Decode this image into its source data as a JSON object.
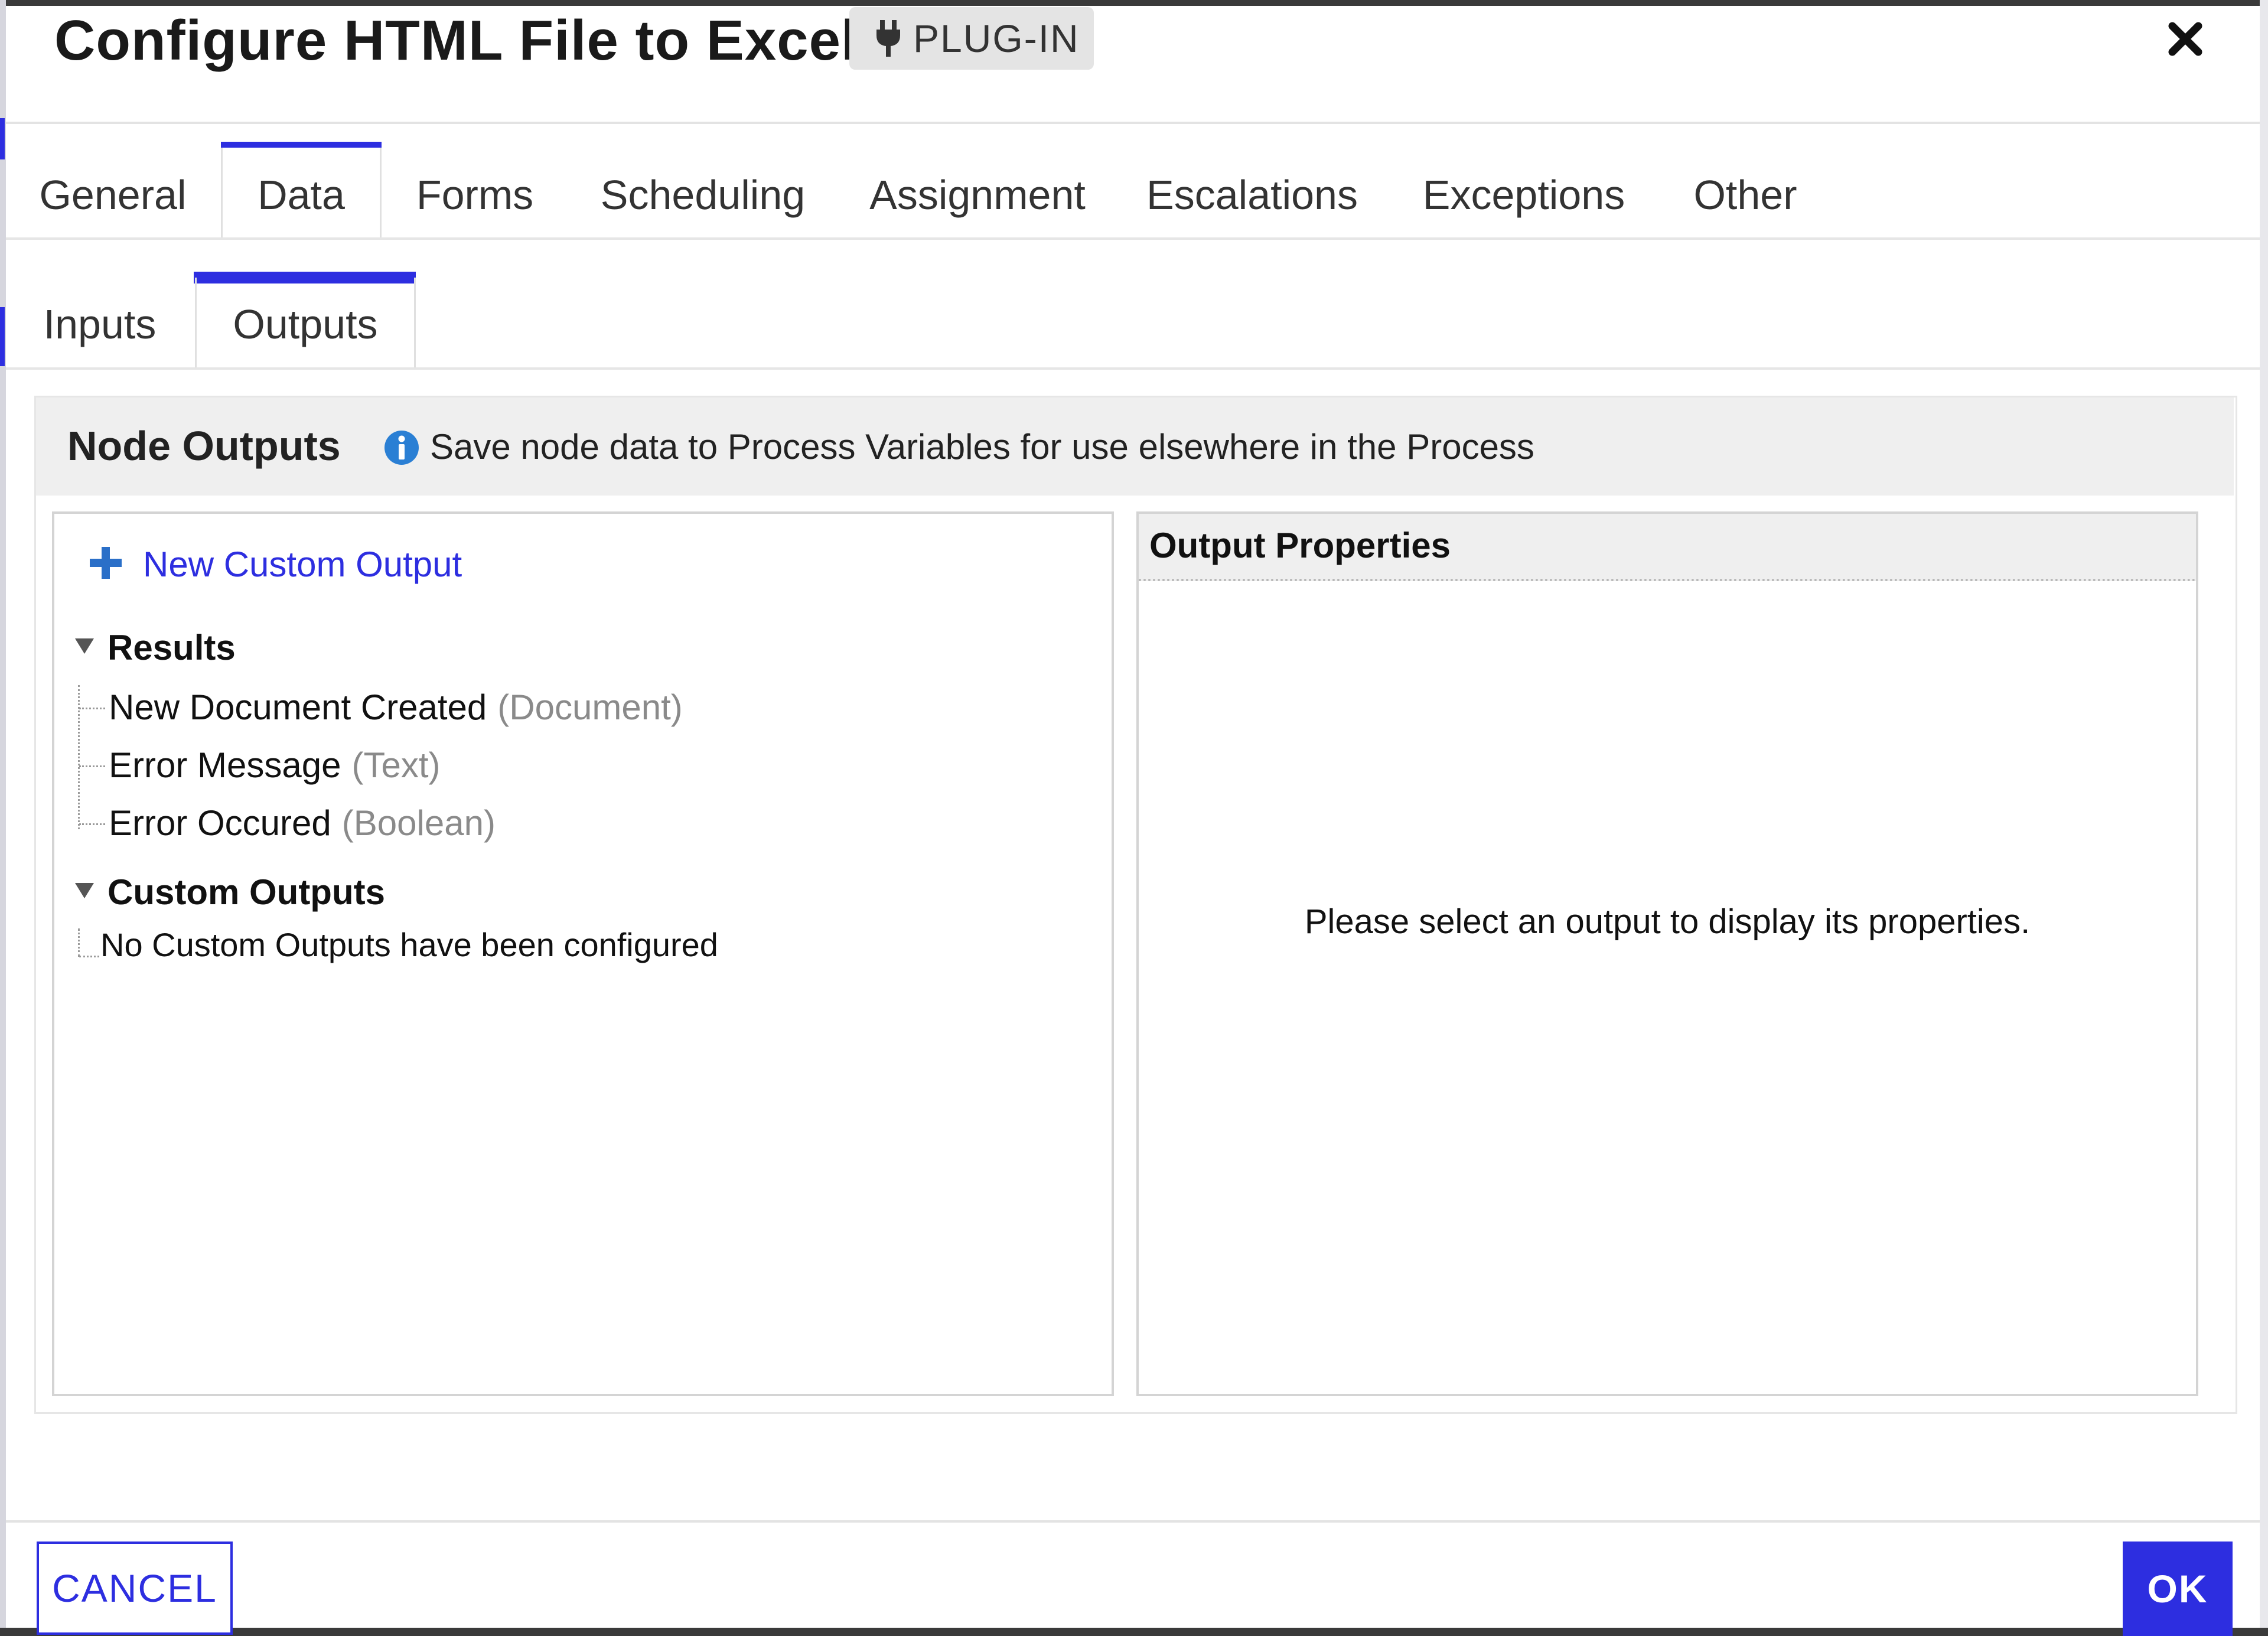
{
  "dialog": {
    "title": "Configure HTML File to Excel",
    "badge_label": "PLUG-IN",
    "badge_icon": "plug-icon",
    "close_icon": "close-icon"
  },
  "tabs": [
    {
      "label": "General",
      "active": false
    },
    {
      "label": "Data",
      "active": true
    },
    {
      "label": "Forms",
      "active": false
    },
    {
      "label": "Scheduling",
      "active": false
    },
    {
      "label": "Assignment",
      "active": false
    },
    {
      "label": "Escalations",
      "active": false
    },
    {
      "label": "Exceptions",
      "active": false
    },
    {
      "label": "Other",
      "active": false
    }
  ],
  "subtabs": [
    {
      "label": "Inputs",
      "active": false
    },
    {
      "label": "Outputs",
      "active": true
    }
  ],
  "node_outputs": {
    "title": "Node Outputs",
    "description": "Save node data to Process Variables for use elsewhere in the Process",
    "info_icon": "info-icon"
  },
  "tree": {
    "new_custom_output_label": "New Custom Output",
    "results": {
      "label": "Results",
      "items": [
        {
          "name": "New Document Created",
          "type": "(Document)"
        },
        {
          "name": "Error Message",
          "type": "(Text)"
        },
        {
          "name": "Error Occured",
          "type": "(Boolean)"
        }
      ]
    },
    "custom_outputs": {
      "label": "Custom Outputs",
      "empty_text": "No Custom Outputs have been configured"
    }
  },
  "properties": {
    "title": "Output Properties",
    "empty_text": "Please select an output to display its properties."
  },
  "footer": {
    "cancel_label": "CANCEL",
    "ok_label": "OK"
  },
  "colors": {
    "accent": "#2d2ee0",
    "panel_header_bg": "#efefef",
    "type_text": "#8a8a8a"
  }
}
